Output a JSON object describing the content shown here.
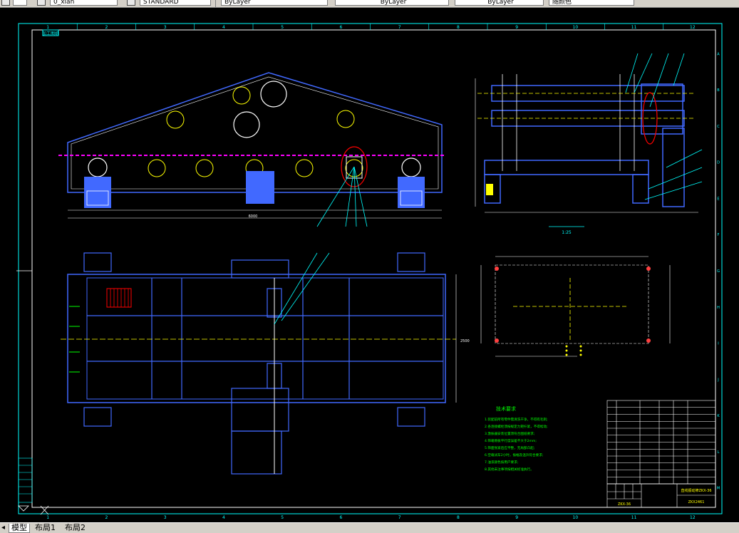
{
  "toolbar": {
    "layer_name": "0_xian",
    "text_style": "STANDARD",
    "color_control": "ByLayer",
    "linetype_control": "ByLayer",
    "lineweight_control": "ByLayer",
    "plotstyle_control": "随颜色"
  },
  "drawing": {
    "title_tag": "加工图纸",
    "grid_cols": [
      "1",
      "2",
      "3",
      "4",
      "5",
      "6",
      "7",
      "8",
      "9",
      "10",
      "11",
      "12"
    ],
    "grid_rows": [
      "A",
      "B",
      "C",
      "D",
      "E",
      "F",
      "G",
      "H",
      "I",
      "J",
      "K",
      "L",
      "M"
    ],
    "tech_req_title": "技术要求",
    "tech_req_lines": [
      "1.装配前所有零件需清洗干净，不得有毛刺;",
      "2.各连接螺栓须按规定力矩拧紧，不得松动;",
      "3.激振器安装位置须符合图纸要求;",
      "4.筛箱侧板平行度误差不大于2mm;",
      "5.筛面张紧后应平整，无局部凸起;",
      "6.空载试车2小时，振幅及温升符合要求;",
      "7.油漆颜色按用户要求;",
      "8.其他未注事项按相关标准执行。"
    ],
    "dim_total_length": "6000",
    "dim_width": "2500",
    "scale_label": "1:25",
    "title_block_name": "直线振动筛ZKX-36",
    "title_block_sub": "ZKX2461",
    "drawing_no": "ZKX-36"
  },
  "tabs": {
    "model": "模型",
    "layout1": "布局1",
    "layout2": "布局2"
  }
}
